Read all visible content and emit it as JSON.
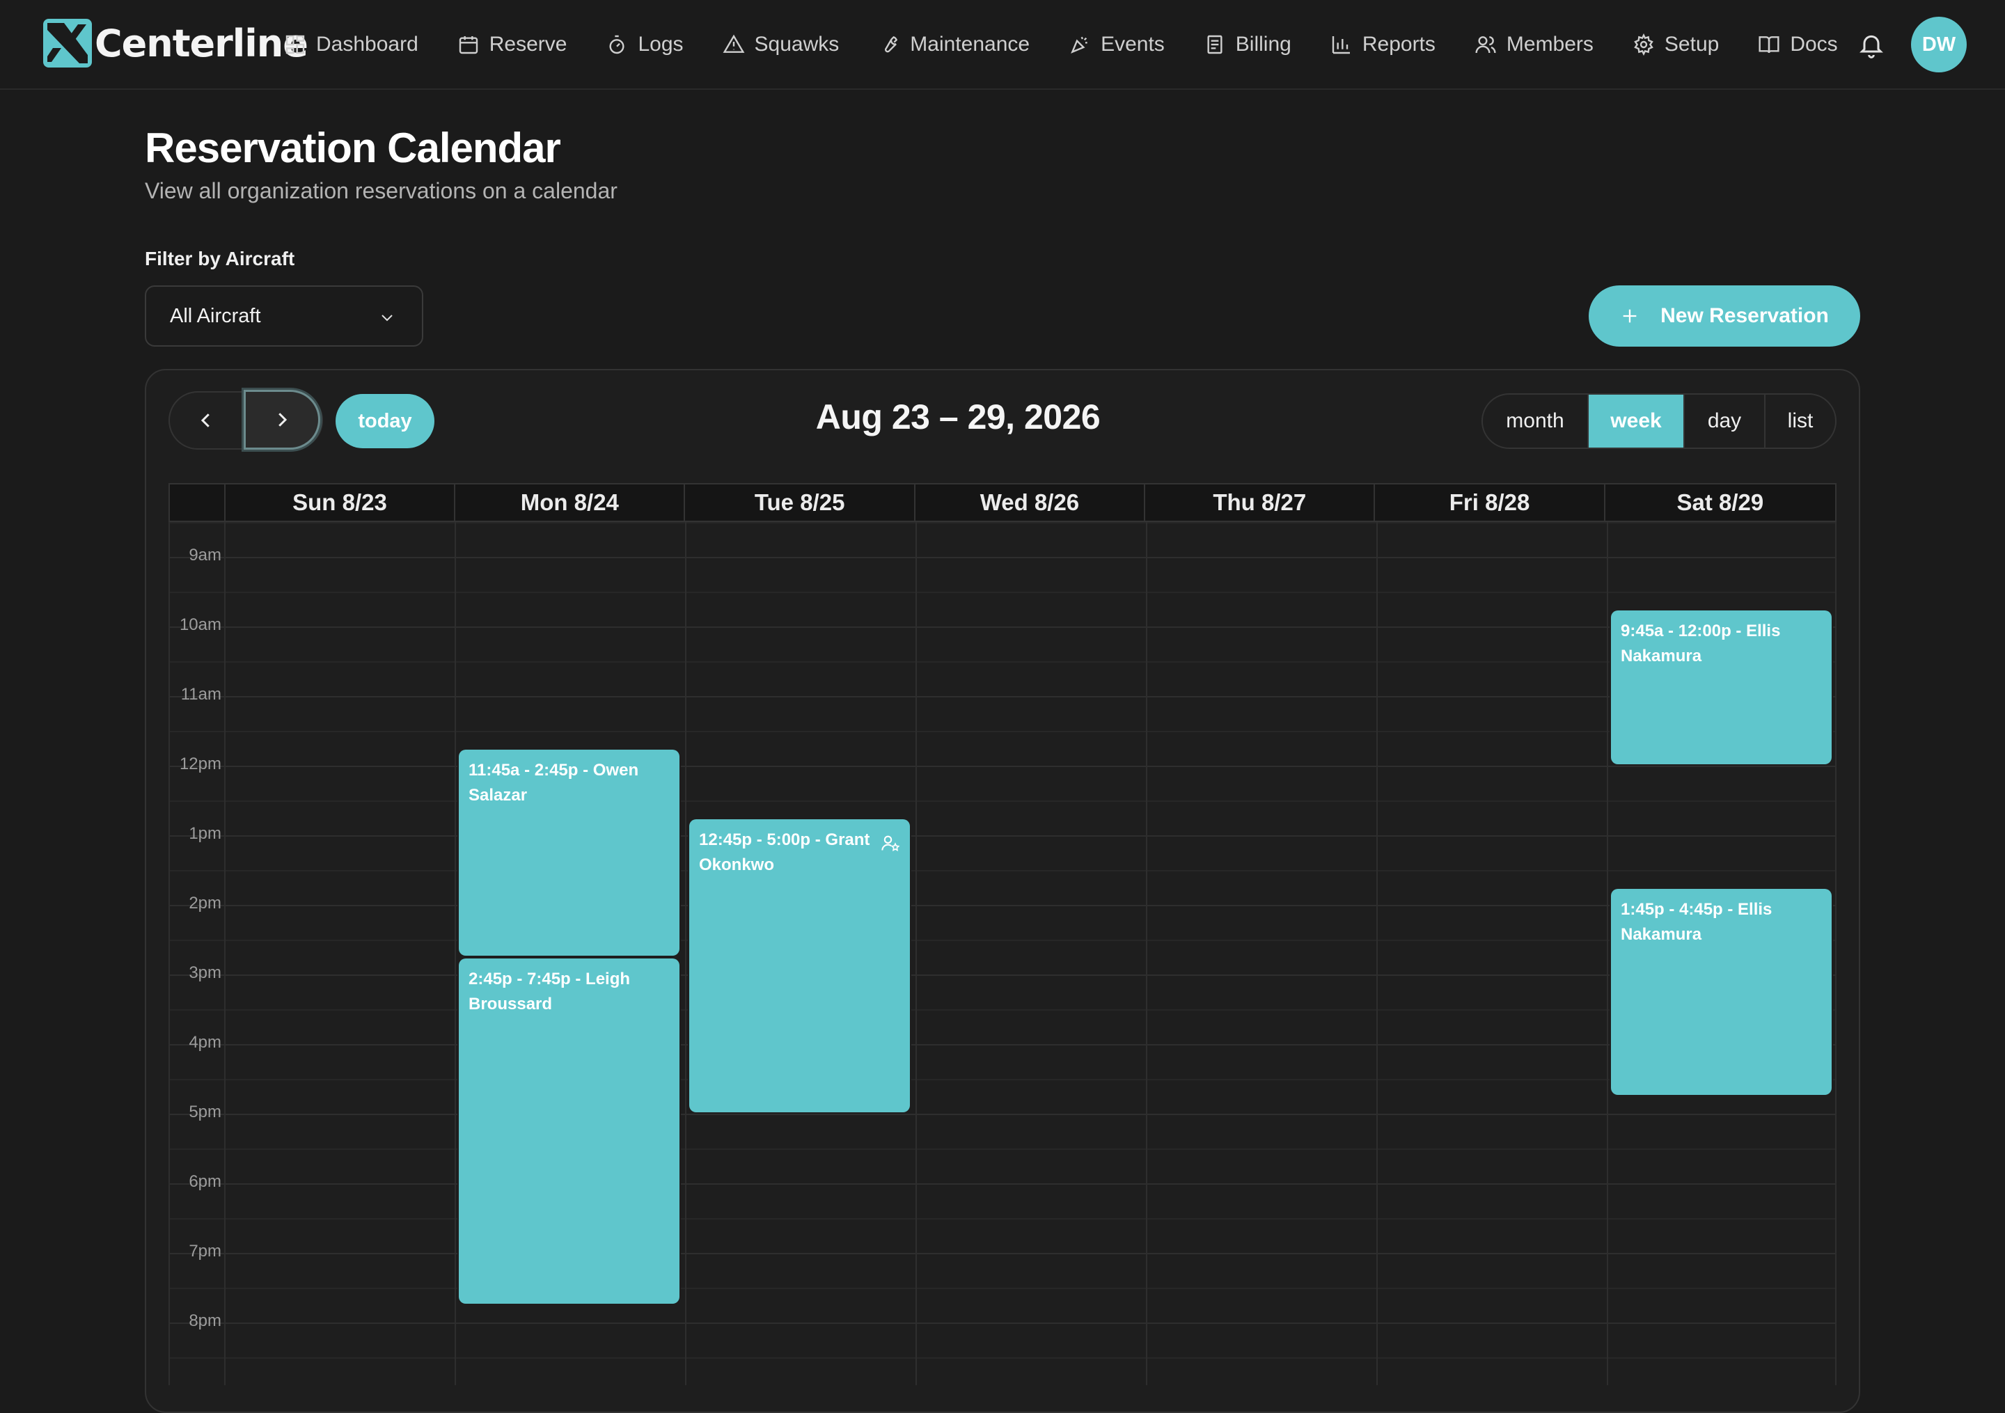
{
  "app": {
    "name": "Centerline"
  },
  "nav": {
    "items": [
      {
        "label": "Dashboard",
        "icon": "grid-icon"
      },
      {
        "label": "Reserve",
        "icon": "calendar-icon"
      },
      {
        "label": "Logs",
        "icon": "stopwatch-icon"
      },
      {
        "label": "Squawks",
        "icon": "warning-icon"
      },
      {
        "label": "Maintenance",
        "icon": "wrench-icon"
      },
      {
        "label": "Events",
        "icon": "party-popper-icon"
      },
      {
        "label": "Billing",
        "icon": "receipt-icon"
      },
      {
        "label": "Reports",
        "icon": "bar-chart-icon"
      },
      {
        "label": "Members",
        "icon": "users-icon"
      },
      {
        "label": "Setup",
        "icon": "gear-icon"
      },
      {
        "label": "Docs",
        "icon": "book-icon"
      }
    ],
    "notifications_icon": "bell-icon",
    "avatar_initials": "DW"
  },
  "header": {
    "title": "Reservation Calendar",
    "subtitle": "View all organization reservations on a calendar"
  },
  "filter": {
    "label": "Filter by Aircraft",
    "selected": "All Aircraft"
  },
  "new_reservation_label": "New Reservation",
  "calendar": {
    "range_title": "Aug 23 – 29, 2026",
    "today_label": "today",
    "views": [
      "month",
      "week",
      "day",
      "list"
    ],
    "active_view": "week",
    "days": [
      "Sun 8/23",
      "Mon 8/24",
      "Tue 8/25",
      "Wed 8/26",
      "Thu 8/27",
      "Fri 8/28",
      "Sat 8/29"
    ],
    "time_labels": [
      "9am",
      "10am",
      "11am",
      "12pm",
      "1pm",
      "2pm",
      "3pm",
      "4pm",
      "5pm",
      "6pm",
      "7pm",
      "8pm"
    ],
    "events": [
      {
        "day": 1,
        "start": 11.75,
        "end": 14.75,
        "label": "11:45a - 2:45p - Owen Salazar",
        "icon": false
      },
      {
        "day": 1,
        "start": 14.75,
        "end": 19.75,
        "label": "2:45p - 7:45p - Leigh Broussard",
        "icon": false
      },
      {
        "day": 2,
        "start": 12.75,
        "end": 17.0,
        "label": "12:45p - 5:00p - Grant Okonkwo",
        "icon": true
      },
      {
        "day": 6,
        "start": 9.75,
        "end": 12.0,
        "label": "9:45a - 12:00p - Ellis Nakamura",
        "icon": false
      },
      {
        "day": 6,
        "start": 13.75,
        "end": 16.75,
        "label": "1:45p - 4:45p - Ellis Nakamura",
        "icon": false
      }
    ],
    "colors": {
      "accent": "#5fc6cc",
      "background": "#1b1b1b"
    }
  }
}
